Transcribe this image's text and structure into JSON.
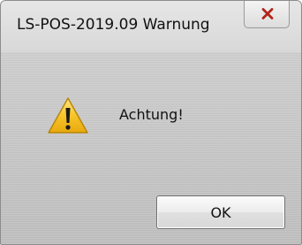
{
  "window": {
    "title": "LS-POS-2019.09 Warnung"
  },
  "close": {
    "icon": "close-icon",
    "color": "#c42b1c"
  },
  "message": {
    "icon": "warning-icon",
    "text": "Achtung!"
  },
  "buttons": {
    "ok_label": "OK"
  }
}
